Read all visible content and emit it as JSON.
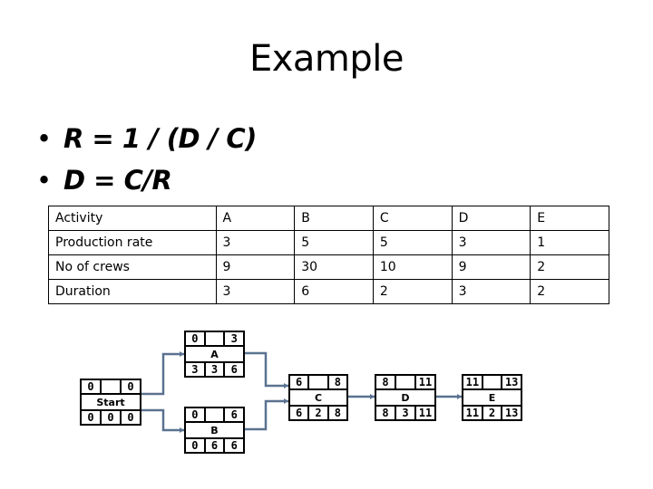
{
  "title": "Example",
  "bullets": [
    {
      "marker": "•",
      "text": "R = 1 / (D / C)"
    },
    {
      "marker": "•",
      "text": "D = C/R"
    }
  ],
  "table": {
    "rows": [
      [
        "Activity",
        "A",
        "B",
        "C",
        "D",
        "E"
      ],
      [
        "Production rate",
        "3",
        "5",
        "5",
        "3",
        "1"
      ],
      [
        "No of crews",
        "9",
        "30",
        "10",
        "9",
        "2"
      ],
      [
        "Duration",
        "3",
        "6",
        "2",
        "3",
        "2"
      ]
    ]
  },
  "network": {
    "connector_color": "#5a7290",
    "nodes": {
      "start": {
        "name": "Start",
        "es": "0",
        "ef": "0",
        "ls": "0",
        "dur": "0",
        "lf": "0",
        "tl": ""
      },
      "a": {
        "name": "A",
        "es": "0",
        "ef": "3",
        "ls": "3",
        "dur": "3",
        "lf": "6",
        "tl": ""
      },
      "b": {
        "name": "B",
        "es": "0",
        "ef": "6",
        "ls": "0",
        "dur": "6",
        "lf": "6",
        "tl": ""
      },
      "c": {
        "name": "C",
        "es": "6",
        "ef": "8",
        "ls": "6",
        "dur": "2",
        "lf": "8",
        "tl": ""
      },
      "d": {
        "name": "D",
        "es": "8",
        "ef": "11",
        "ls": "8",
        "dur": "3",
        "lf": "11",
        "tl": ""
      },
      "e": {
        "name": "E",
        "es": "11",
        "ef": "13",
        "ls": "11",
        "dur": "2",
        "lf": "13",
        "tl": ""
      }
    },
    "edges": [
      {
        "from": "Start",
        "to": "A"
      },
      {
        "from": "Start",
        "to": "B"
      },
      {
        "from": "A",
        "to": "C"
      },
      {
        "from": "B",
        "to": "C"
      },
      {
        "from": "C",
        "to": "D"
      },
      {
        "from": "D",
        "to": "E"
      }
    ]
  }
}
